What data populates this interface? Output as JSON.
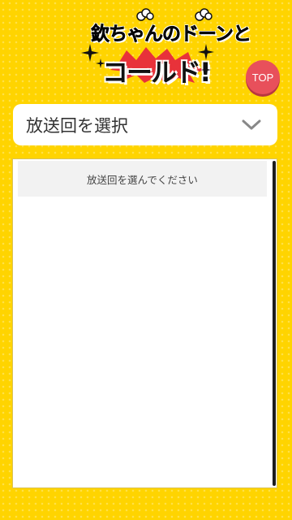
{
  "logo": {
    "line1": "欽ちゃんのドーンと",
    "line2": "コールド!",
    "icon": "show-logo"
  },
  "top_button": {
    "label": "TOP",
    "color": "#e8505b"
  },
  "episode_select": {
    "selected_label": "放送回を選択",
    "icon": "chevron-down-icon"
  },
  "episode_list": {
    "placeholder": "放送回を選んでください"
  },
  "colors": {
    "background": "#ffd400",
    "panel": "#ffffff",
    "accent": "#e8505b"
  }
}
